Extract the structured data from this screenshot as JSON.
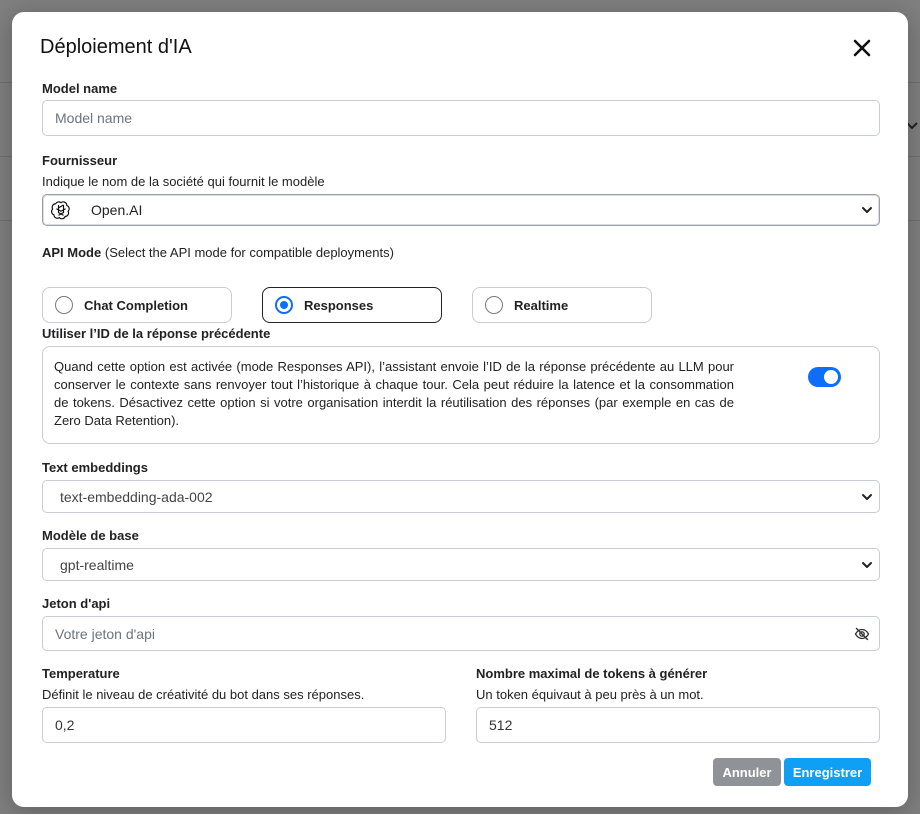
{
  "modal": {
    "title": "Déploiement d'IA"
  },
  "model_name": {
    "label": "Model name",
    "placeholder": "Model name",
    "value": ""
  },
  "provider": {
    "label": "Fournisseur",
    "help": "Indique le nom de la société qui fournit le modèle",
    "selected": "Open.AI",
    "icon": "openai-logo-icon"
  },
  "api_mode": {
    "label": "API Mode",
    "label_hint": "(Select the API mode for compatible deployments)",
    "options": [
      {
        "label": "Chat Completion",
        "selected": false
      },
      {
        "label": "Responses",
        "selected": true
      },
      {
        "label": "Realtime",
        "selected": false
      }
    ]
  },
  "previous_response": {
    "label": "Utiliser l’ID de la réponse précédente",
    "description": "Quand cette option est activée (mode Responses API), l’assistant envoie l’ID de la réponse précédente au LLM pour conserver le contexte sans renvoyer tout l’historique à chaque tour. Cela peut réduire la latence et la consommation de tokens. Désactivez cette option si votre organisation interdit la réutilisation des réponses (par exemple en cas de Zero Data Retention).",
    "enabled": true
  },
  "text_embeddings": {
    "label": "Text embeddings",
    "selected": "text-embedding-ada-002"
  },
  "base_model": {
    "label": "Modèle de base",
    "selected": "gpt-realtime"
  },
  "api_token": {
    "label": "Jeton d'api",
    "placeholder": "Votre jeton d'api",
    "value": ""
  },
  "temperature": {
    "label": "Temperature",
    "help": "Définit le niveau de créativité du bot dans ses réponses.",
    "value": "0,2"
  },
  "max_tokens": {
    "label": "Nombre maximal de tokens à générer",
    "help": "Un token équivaut à peu près à un mot.",
    "value": "512"
  },
  "actions": {
    "cancel_label": "Annuler",
    "save_label": "Enregistrer"
  },
  "colors": {
    "accent": "#0d6efd",
    "save_button": "#0fa0f5",
    "cancel_button": "#8f9296",
    "overlay": "#7f7f7f"
  }
}
